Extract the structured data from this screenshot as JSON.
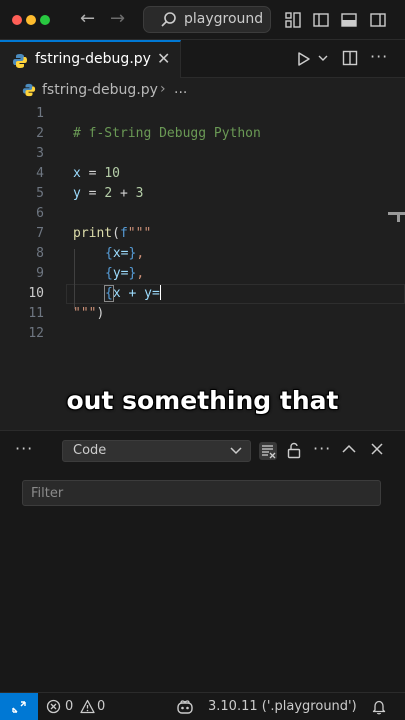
{
  "titlebar": {
    "search_text": "playground",
    "nav_back": "←",
    "nav_forward": "→"
  },
  "tab": {
    "filename": "fstring-debug.py",
    "close_glyph": "✕"
  },
  "breadcrumb": {
    "file": "fstring-debug.py",
    "separator": "›",
    "more": "..."
  },
  "editor": {
    "active_line": 10,
    "line_numbers": [
      "1",
      "2",
      "3",
      "4",
      "5",
      "6",
      "7",
      "8",
      "9",
      "10",
      "11",
      "12"
    ],
    "lines": {
      "l2": "# f-String Debugg Python",
      "l4_var": "x",
      "l4_op": " = ",
      "l4_num": "10",
      "l5_var": "y",
      "l5_op": " = ",
      "l5_num1": "2",
      "l5_op2": " + ",
      "l5_num2": "3",
      "l7_fn": "print",
      "l7_paren": "(",
      "l7_prefix": "f",
      "l7_str": "\"\"\"",
      "l8_open": "{",
      "l8_expr": "x=",
      "l8_close": "}",
      "l8_tail": ",",
      "l9_open": "{",
      "l9_expr": "y=",
      "l9_close": "}",
      "l9_tail": ",",
      "l10_open": "{",
      "l10_expr": "x + y=",
      "l11_str": "\"\"\"",
      "l11_paren": ")"
    }
  },
  "caption": "out something that",
  "panel": {
    "more": "···",
    "selected_output": "Code",
    "filter_placeholder": "Filter"
  },
  "statusbar": {
    "errors": "0",
    "warnings": "0",
    "python_version": "3.10.11 ('.playground')"
  },
  "colors": {
    "accent": "#0078d4",
    "editor_bg": "#1f1f1f",
    "panel_bg": "#181818"
  }
}
